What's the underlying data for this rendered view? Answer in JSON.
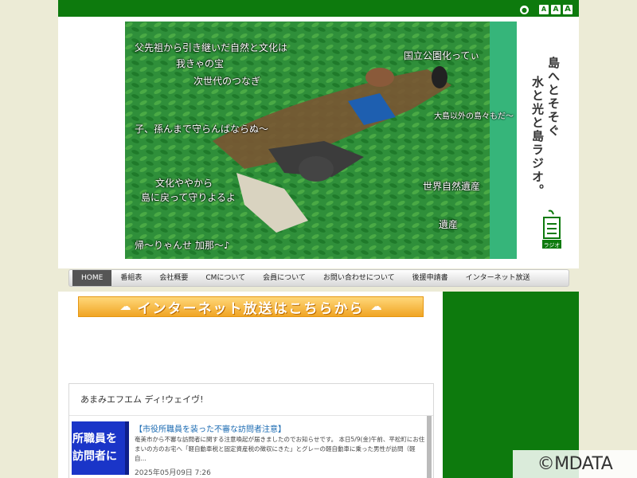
{
  "topbar": {
    "home_icon": "globe-icon",
    "font_sizes": [
      "A",
      "A",
      "A"
    ]
  },
  "banner": {
    "texts": [
      "父先祖から引き継いだ自然と文化は",
      "我きゃの宝",
      "次世代のつなぎ",
      "国立公園化ってぃ",
      "大島以外の島々もだ〜",
      "子、孫んまで守らんばならぬ〜",
      "文化ややから",
      "島に戻って守りよるよ",
      "世界自然遺産",
      "遺産",
      "帰〜りゃんせ 加那〜♪"
    ]
  },
  "slogan": {
    "line1": "島へとそそぐ",
    "line2": "水と光と島ラジオ。"
  },
  "logo": {
    "label": "ラジオ"
  },
  "nav": {
    "items": [
      "HOME",
      "番組表",
      "会社概要",
      "CMについて",
      "会員について",
      "お問い合わせについて",
      "後援申請書",
      "インターネット放送"
    ]
  },
  "promo": {
    "label": "インターネット放送はこちらから"
  },
  "feed": {
    "title": "あまみエフエム ディ!ウェイヴ!",
    "item": {
      "thumb_line1": "所職員を",
      "thumb_line2": "訪問者に",
      "title": "【市役所職員を装った不審な訪問者注意】",
      "body": "奄美市から不審な訪問者に関する注意喚起が届きましたのでお知らせです。 本日5/9(金)午前、平松町にお住まいの方のお宅へ「軽自動車税と固定資産税の徴収にきた」とグレーの軽自動車に乗った男性が訪問（軽自...",
      "date": "2025年05月09日 7:26"
    }
  },
  "watermark": "©MDATA",
  "colors": {
    "brand_green": "#0d7a0d",
    "banner_green": "#2f8f3a",
    "promo_orange": "#f0a524",
    "link_blue": "#1a6ab2"
  }
}
